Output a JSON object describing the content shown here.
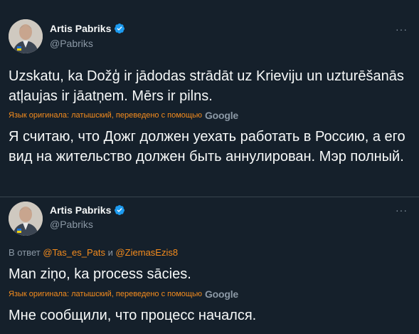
{
  "tweets": [
    {
      "author_name": "Artis Pabriks",
      "author_handle": "@Pabriks",
      "more": "···",
      "original_text": "Uzskatu, ka Dožģ ir jādodas strādāt uz Krieviju un uzturēšanās atļaujas ir jāatņem. Mērs ir pilns.",
      "translation_note": "Язык оригинала: латышский, переведено с помощью",
      "translation_service": "Google",
      "translated_text": "Я считаю, что Дожг должен уехать работать в Россию, а его вид на жительство должен быть аннулирован. Мэр полный."
    },
    {
      "author_name": "Artis Pabriks",
      "author_handle": "@Pabriks",
      "more": "···",
      "reply_prefix": "В ответ",
      "reply_mention_1": "@Tas_es_Pats",
      "reply_and": "и",
      "reply_mention_2": "@ZiemasEzis8",
      "original_text": "Man ziņo, ka process sācies.",
      "translation_note": "Язык оригинала: латышский, переведено с помощью",
      "translation_service": "Google",
      "translated_text": "Мне сообщили, что процесс начался."
    }
  ],
  "icons": {
    "verified": "verified-badge-icon",
    "more": "more-options-icon"
  },
  "colors": {
    "background": "#15202b",
    "text": "#f7f9f9",
    "secondary": "#8b98a5",
    "accent": "#f58c1d",
    "verified": "#1d9bf0",
    "divider": "#38444d"
  }
}
